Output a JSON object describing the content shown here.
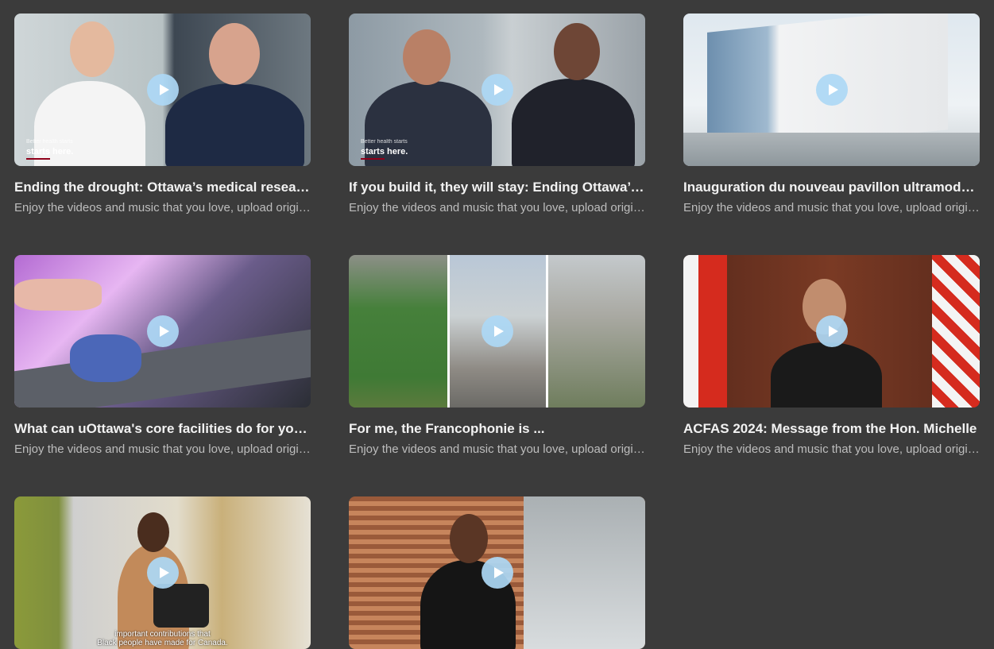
{
  "videos": [
    {
      "title": "Ending the drought: Ottawa’s medical research needs a new building",
      "description": "Enjoy the videos and music that you love, upload original content",
      "caption_small": "Better health starts",
      "caption_large": "starts here."
    },
    {
      "title": "If you build it, they will stay: Ending Ottawa’s research drought",
      "description": "Enjoy the videos and music that you love, upload original content",
      "caption_small": "Better health starts",
      "caption_large": "starts here."
    },
    {
      "title": "Inauguration du nouveau pavillon ultramoderne",
      "description": "Enjoy the videos and music that you love, upload original content"
    },
    {
      "title": "What can uOttawa's core facilities do for your research?",
      "description": "Enjoy the videos and music that you love, upload original content"
    },
    {
      "title": "For me, the Francophonie is ...",
      "description": "Enjoy the videos and music that you love, upload original content"
    },
    {
      "title": "ACFAS 2024: Message from the Hon. Michelle",
      "description": "Enjoy the videos and music that you love, upload original content"
    },
    {
      "title": "",
      "description": "",
      "subtitle_line1": "important contributions that",
      "subtitle_line2": "Black people have made for Canada."
    },
    {
      "title": "",
      "description": ""
    }
  ],
  "icons": {
    "play": "play-icon"
  },
  "colors": {
    "background": "#3b3b3b",
    "play_button": "#add8f5",
    "title": "#f2f2f2",
    "description": "#bdbdbd"
  }
}
